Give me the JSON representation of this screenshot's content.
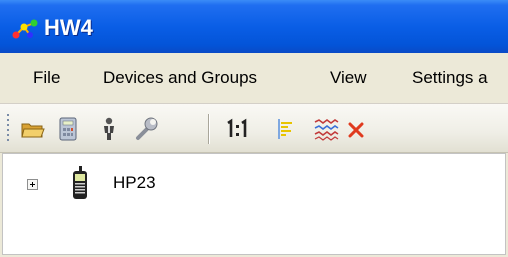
{
  "window": {
    "title": "HW4",
    "icon": "molecule-app-icon"
  },
  "menubar": {
    "items": [
      {
        "label": "File"
      },
      {
        "label": "Devices and Groups"
      },
      {
        "label": "View"
      },
      {
        "label": "Settings a"
      }
    ]
  },
  "toolbar": {
    "buttons": [
      {
        "icon": "open-folder-icon"
      },
      {
        "icon": "calculator-icon"
      },
      {
        "icon": "person-icon"
      },
      {
        "icon": "wrench-icon"
      },
      {
        "icon": "one-to-one-icon",
        "label": "1:1"
      },
      {
        "icon": "align-list-icon"
      },
      {
        "icon": "waveform-icon"
      },
      {
        "icon": "delete-x-icon"
      }
    ]
  },
  "tree": {
    "items": [
      {
        "label": "HP23",
        "icon": "handheld-radio-icon",
        "expanded": false
      }
    ]
  },
  "colors": {
    "titlebar": "#0a5ee6",
    "menubar": "#ece9d8",
    "delete_red": "#e03a1e"
  }
}
